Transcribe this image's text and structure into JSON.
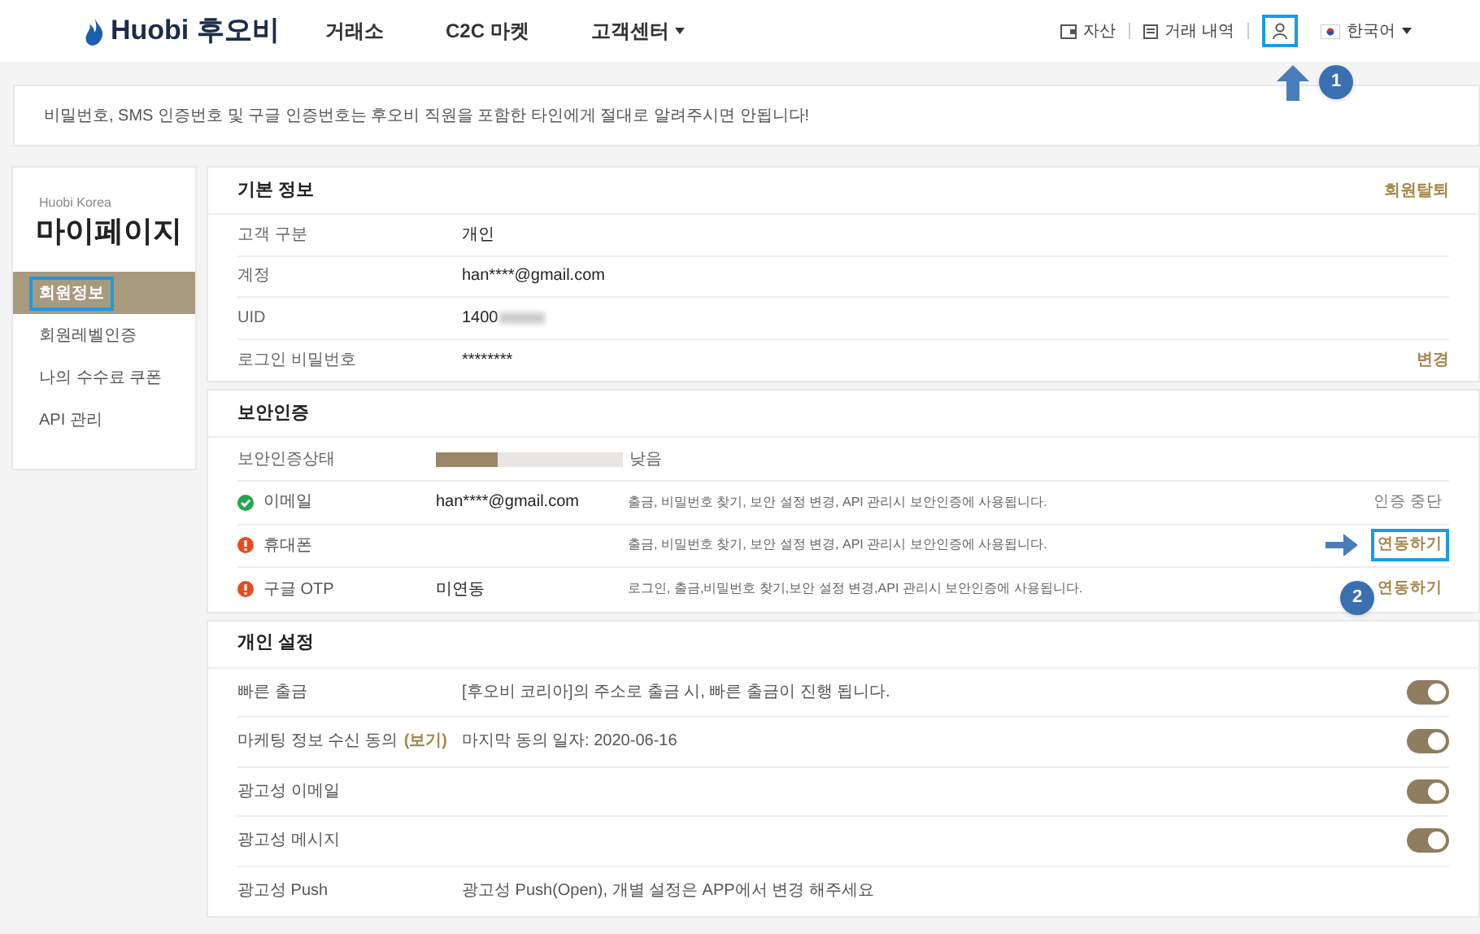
{
  "header": {
    "logo": "Huobi",
    "logo_suffix": "후오비",
    "nav": [
      {
        "label": "거래소",
        "dropdown": false
      },
      {
        "label": "C2C 마켓",
        "dropdown": false
      },
      {
        "label": "고객센터",
        "dropdown": true
      }
    ],
    "assets": "자산",
    "history": "거래 내역",
    "language": "한국어"
  },
  "notice": "비밀번호, SMS 인증번호 및 구글 인증번호는 후오비 직원을 포함한 타인에게 절대로 알려주시면 안됩니다!",
  "sidebar": {
    "brand": "Huobi Korea",
    "title": "마이페이지",
    "items": [
      {
        "label": "회원정보",
        "selected": true
      },
      {
        "label": "회원레벨인증",
        "selected": false
      },
      {
        "label": "나의 수수료 쿠폰",
        "selected": false
      },
      {
        "label": "API 관리",
        "selected": false
      }
    ]
  },
  "basic_info": {
    "title": "기본 정보",
    "action": "회원탈퇴",
    "rows": [
      {
        "label": "고객 구분",
        "value": "개인",
        "blurred": false
      },
      {
        "label": "계정",
        "value": "han****@gmail.com",
        "blurred": false
      },
      {
        "label": "UID",
        "value": "1400",
        "blurred": true
      },
      {
        "label": "로그인 비밀번호",
        "value": "********",
        "blurred": false,
        "action": "변경"
      }
    ]
  },
  "security": {
    "title": "보안인증",
    "status_label": "보안인증상태",
    "level": 0.33,
    "level_text": "낮음",
    "rows": [
      {
        "kind": "verified",
        "label": "이메일",
        "value": "han****@gmail.com",
        "description": "출금, 비밀번호 찾기, 보안 설정 변경, API 관리시 보안인증에 사용됩니다.",
        "action": "인증 중단",
        "highlighted": false
      },
      {
        "kind": "unverified",
        "label": "휴대폰",
        "description": "출금, 비밀번호 찾기, 보안 설정 변경, API 관리시 보안인증에 사용됩니다.",
        "action": "연동하기",
        "highlighted": true
      },
      {
        "kind": "unverified",
        "label": "구글 OTP",
        "value": "미연동",
        "description": "로그인, 출금,비밀번호 찾기,보안 설정 변경,API 관리시 보안인증에 사용됩니다.",
        "action": "연동하기",
        "highlighted": false
      }
    ]
  },
  "personal": {
    "title": "개인 설정",
    "rows": [
      {
        "label": "빠른 출금",
        "description": "[후오비 코리아]의 주소로 출금 시, 빠른 출금이 진행 됩니다.",
        "on": true
      },
      {
        "label": "마케팅 정보 수신 동의",
        "link": "(보기)",
        "description": "마지막 동의 일자: 2020-06-16",
        "on": true
      },
      {
        "label": "광고성 이메일",
        "on": true
      },
      {
        "label": "광고성 메시지",
        "on": true
      },
      {
        "label": "광고성 Push",
        "description": "광고성 Push(Open), 개별 설정은 APP에서 변경 해주세요"
      }
    ]
  },
  "annotations": [
    {
      "number": "1"
    },
    {
      "number": "2"
    }
  ]
}
